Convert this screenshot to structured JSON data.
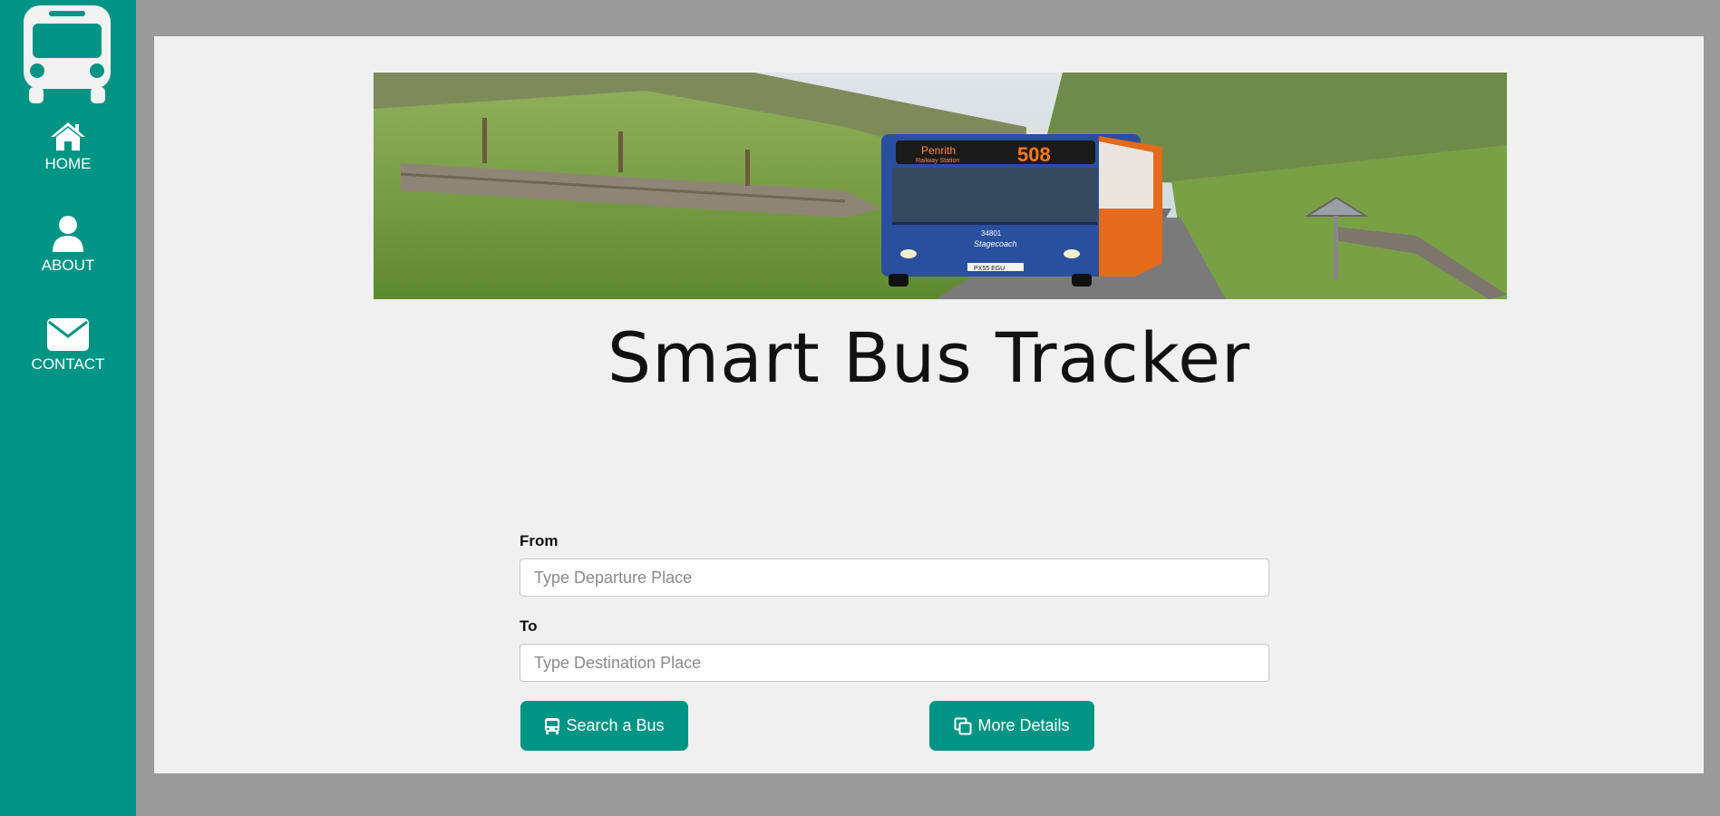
{
  "sidebar": {
    "logo_icon": "bus-icon",
    "items": [
      {
        "label": "HOME",
        "icon": "home-icon"
      },
      {
        "label": "ABOUT",
        "icon": "user-icon"
      },
      {
        "label": "CONTACT",
        "icon": "envelope-icon"
      }
    ]
  },
  "main": {
    "banner": {
      "destination_text": "Penrith",
      "destination_subtext": "Railway Station",
      "route_number": "508",
      "fleet_number": "34801",
      "operator": "Stagecoach",
      "plate": "PX55 EGU"
    },
    "title": "Smart Bus Tracker",
    "form": {
      "from_label": "From",
      "from_placeholder": "Type Departure Place",
      "to_label": "To",
      "to_placeholder": "Type Destination Place",
      "search_button": "Search a Bus",
      "details_button": "More Details"
    }
  },
  "colors": {
    "accent": "#009485",
    "page_bg": "#9a9a9a",
    "panel_bg": "#f0f0f0"
  }
}
